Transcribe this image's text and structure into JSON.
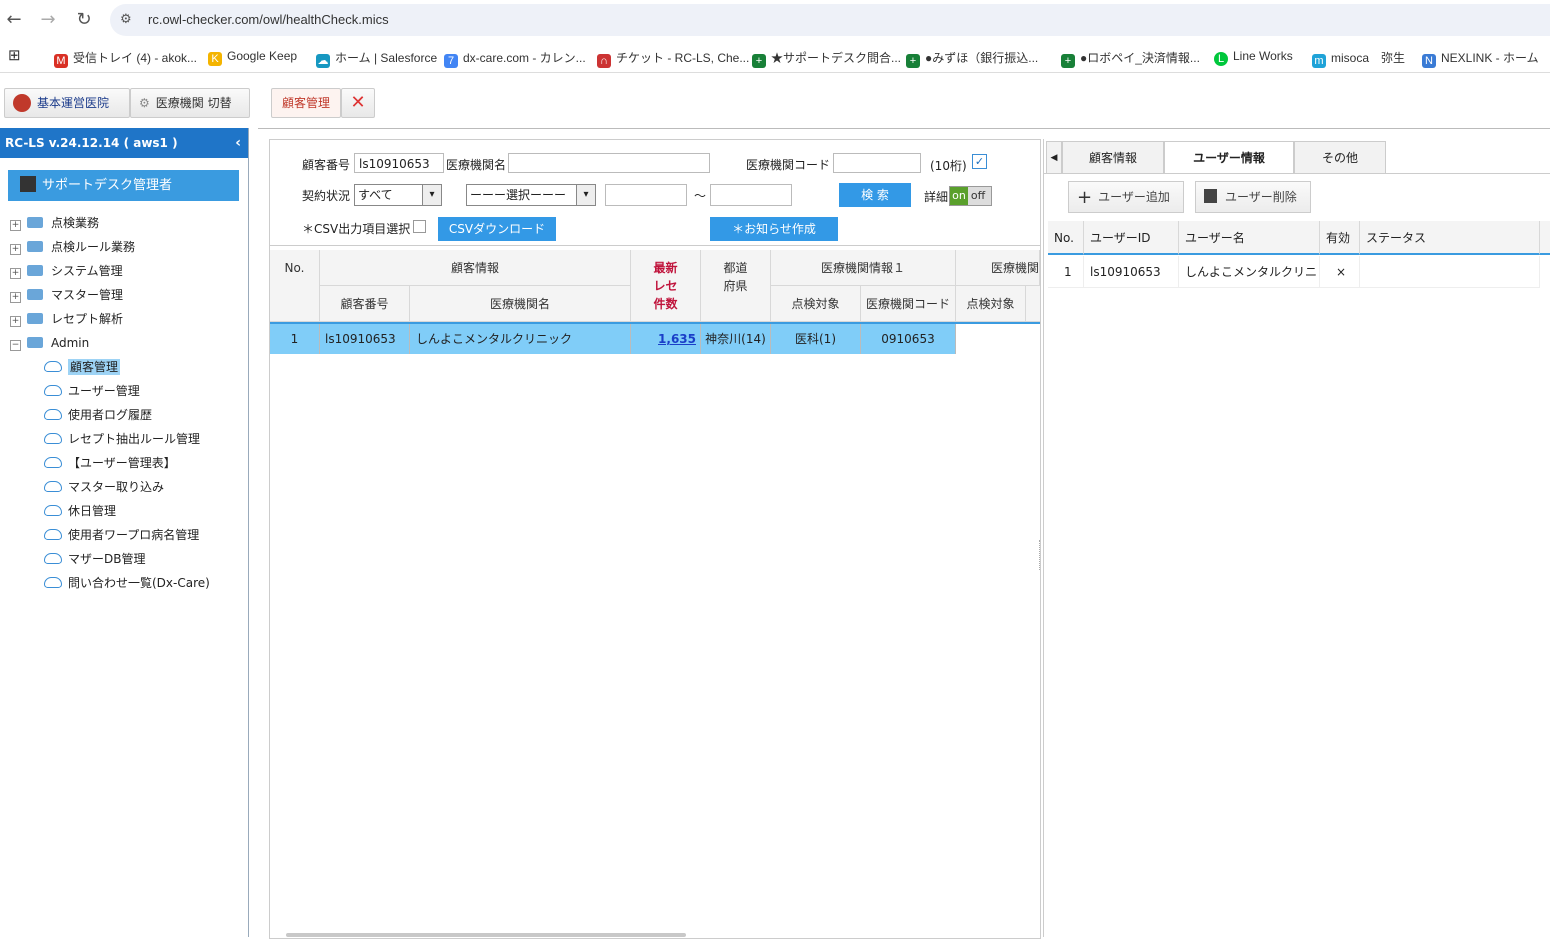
{
  "browser": {
    "url": "rc.owl-checker.com/owl/healthCheck.mics",
    "bookmarks": [
      {
        "label": "受信トレイ (4) - akok...",
        "color": "#d93025",
        "glyph": "M"
      },
      {
        "label": "Google Keep",
        "color": "#f4b400",
        "glyph": "K"
      },
      {
        "label": "ホーム | Salesforce",
        "color": "#1798c1",
        "glyph": "☁"
      },
      {
        "label": "dx-care.com - カレン...",
        "color": "#4285f4",
        "glyph": "7"
      },
      {
        "label": "チケット - RC-LS, Che...",
        "color": "#cc3333",
        "glyph": "∩"
      },
      {
        "label": "★サポートデスク問合...",
        "color": "#188038",
        "glyph": "+"
      },
      {
        "label": "●みずほ（銀行振込...",
        "color": "#188038",
        "glyph": "+"
      },
      {
        "label": "●ロボペイ_決済情報...",
        "color": "#188038",
        "glyph": "+"
      },
      {
        "label": "Line Works",
        "color": "#00c73c",
        "glyph": "L"
      },
      {
        "label": "misoca　弥生",
        "color": "#1fa3d8",
        "glyph": "m"
      },
      {
        "label": "NEXLINK - ホーム",
        "color": "#3a7bd5",
        "glyph": "N"
      }
    ]
  },
  "toolbar": {
    "clinic_label": "基本運営医院",
    "switch_label": "医療機関 切替",
    "tab_label": "顧客管理"
  },
  "sidebar": {
    "version": "RC-LS v.24.12.14 ( aws1 )",
    "user": "サポートデスク管理者",
    "folders": [
      "点検業務",
      "点検ルール業務",
      "システム管理",
      "マスター管理",
      "レセプト解析",
      "Admin"
    ],
    "admin_items": [
      "顧客管理",
      "ユーザー管理",
      "使用者ログ履歴",
      "レセプト抽出ルール管理",
      "【ユーザー管理表】",
      "マスター取り込み",
      "休日管理",
      "使用者ワープロ病名管理",
      "マザーDB管理",
      "問い合わせ一覧(Dx-Care)"
    ]
  },
  "search": {
    "customer_no_label": "顧客番号",
    "customer_no_value": "ls10910653",
    "facility_name_label": "医療機関名",
    "facility_name_value": "",
    "facility_code_label": "医療機関コード",
    "facility_code_value": "",
    "digits_label": "(10桁)",
    "contract_label": "契約状況",
    "contract_value": "すべて",
    "select_value": "ーーー選択ーーー",
    "tilde": "〜",
    "search_button": "検 索",
    "detail_label": "詳細",
    "toggle_on": "on",
    "toggle_off": "off",
    "csv_item_label": "＊CSV出力項目選択",
    "csv_download": "CSVダウンロード",
    "notice_create": "＊お知らせ作成"
  },
  "grid": {
    "headers": {
      "no": "No.",
      "customer_info": "顧客情報",
      "customer_no": "顧客番号",
      "facility_name": "医療機関名",
      "latest_rece_1": "最新",
      "latest_rece_2": "レセ",
      "latest_rece_3": "件数",
      "pref_1": "都道",
      "pref_2": "府県",
      "fac_info_1": "医療機関情報１",
      "check_target": "点検対象",
      "fac_code": "医療機関コード",
      "fac_info_2": "医療機関",
      "check_target_2": "点検対象"
    },
    "rows": [
      {
        "no": "1",
        "customer_no": "ls10910653",
        "facility_name": "しんよこメンタルクリニック",
        "rece_count": "1,635",
        "pref": "神奈川(14)",
        "check_target": "医科(1)",
        "fac_code": "0910653"
      }
    ]
  },
  "right": {
    "tabs": [
      "顧客情報",
      "ユーザー情報",
      "その他"
    ],
    "add_user": "ユーザー追加",
    "delete_user": "ユーザー削除",
    "headers": [
      "No.",
      "ユーザーID",
      "ユーザー名",
      "有効",
      "ステータス"
    ],
    "rows": [
      {
        "no": "1",
        "user_id": "ls10910653",
        "user_name": "しんよこメンタルクリニ",
        "valid": "×",
        "status": ""
      }
    ]
  }
}
